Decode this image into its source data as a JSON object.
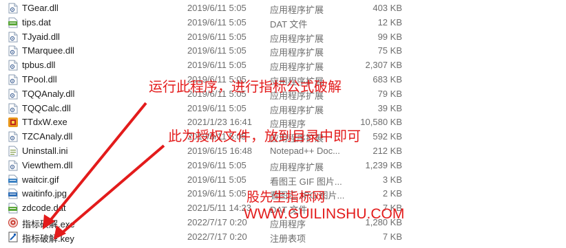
{
  "files": [
    {
      "name": "TGear.dll",
      "date": "2019/6/11 5:05",
      "type": "应用程序扩展",
      "size": "403 KB",
      "icon": "dll-file-icon"
    },
    {
      "name": "tips.dat",
      "date": "2019/6/11 5:05",
      "type": "DAT 文件",
      "size": "12 KB",
      "icon": "dat-file-icon"
    },
    {
      "name": "TJyaid.dll",
      "date": "2019/6/11 5:05",
      "type": "应用程序扩展",
      "size": "99 KB",
      "icon": "dll-file-icon"
    },
    {
      "name": "TMarquee.dll",
      "date": "2019/6/11 5:05",
      "type": "应用程序扩展",
      "size": "75 KB",
      "icon": "dll-file-icon"
    },
    {
      "name": "tpbus.dll",
      "date": "2019/6/11 5:05",
      "type": "应用程序扩展",
      "size": "2,307 KB",
      "icon": "dll-file-icon"
    },
    {
      "name": "TPool.dll",
      "date": "2019/6/11 5:05",
      "type": "应用程序扩展",
      "size": "683 KB",
      "icon": "dll-file-icon"
    },
    {
      "name": "TQQAnaly.dll",
      "date": "2019/6/11 5:05",
      "type": "应用程序扩展",
      "size": "79 KB",
      "icon": "dll-file-icon"
    },
    {
      "name": "TQQCalc.dll",
      "date": "2019/6/11 5:05",
      "type": "应用程序扩展",
      "size": "39 KB",
      "icon": "dll-file-icon"
    },
    {
      "name": "TTdxW.exe",
      "date": "2021/1/23 16:41",
      "type": "应用程序",
      "size": "10,580 KB",
      "icon": "exe-app-icon"
    },
    {
      "name": "TZCAnaly.dll",
      "date": "2019/6/11 5:05",
      "type": "应用程序扩展",
      "size": "592 KB",
      "icon": "dll-file-icon"
    },
    {
      "name": "Uninstall.ini",
      "date": "2019/6/15 16:48",
      "type": "Notepad++ Doc...",
      "size": "212 KB",
      "icon": "ini-file-icon"
    },
    {
      "name": "Viewthem.dll",
      "date": "2019/6/11 5:05",
      "type": "应用程序扩展",
      "size": "1,239 KB",
      "icon": "dll-file-icon"
    },
    {
      "name": "waitcir.gif",
      "date": "2019/6/11 5:05",
      "type": "看图王 GIF 图片...",
      "size": "3 KB",
      "icon": "gif-image-icon"
    },
    {
      "name": "waitinfo.jpg",
      "date": "2019/6/11 5:05",
      "type": "看图王 JPG 图片...",
      "size": "2 KB",
      "icon": "jpg-image-icon"
    },
    {
      "name": "zdcode.dat",
      "date": "2021/5/11 14:23",
      "type": "DAT 文件",
      "size": "7 KB",
      "icon": "dat-file-icon"
    },
    {
      "name": "指标破解.exe",
      "date": "2022/7/17 0:20",
      "type": "应用程序",
      "size": "1,280 KB",
      "icon": "crack-app-icon"
    },
    {
      "name": "指标破解.key",
      "date": "2022/7/17 0:20",
      "type": "注册表项",
      "size": "7 KB",
      "icon": "key-file-icon"
    }
  ],
  "overlay": {
    "instruction1": "运行此程序，进行指标公式破解",
    "instruction2": "此为授权文件，放到目录中即可",
    "watermark_cn": "股先生指标网",
    "watermark_url": "WWW.GUILINSHU.COM"
  },
  "colors": {
    "annotation": "#e31b1b",
    "secondary_text": "#6d6d6d"
  }
}
